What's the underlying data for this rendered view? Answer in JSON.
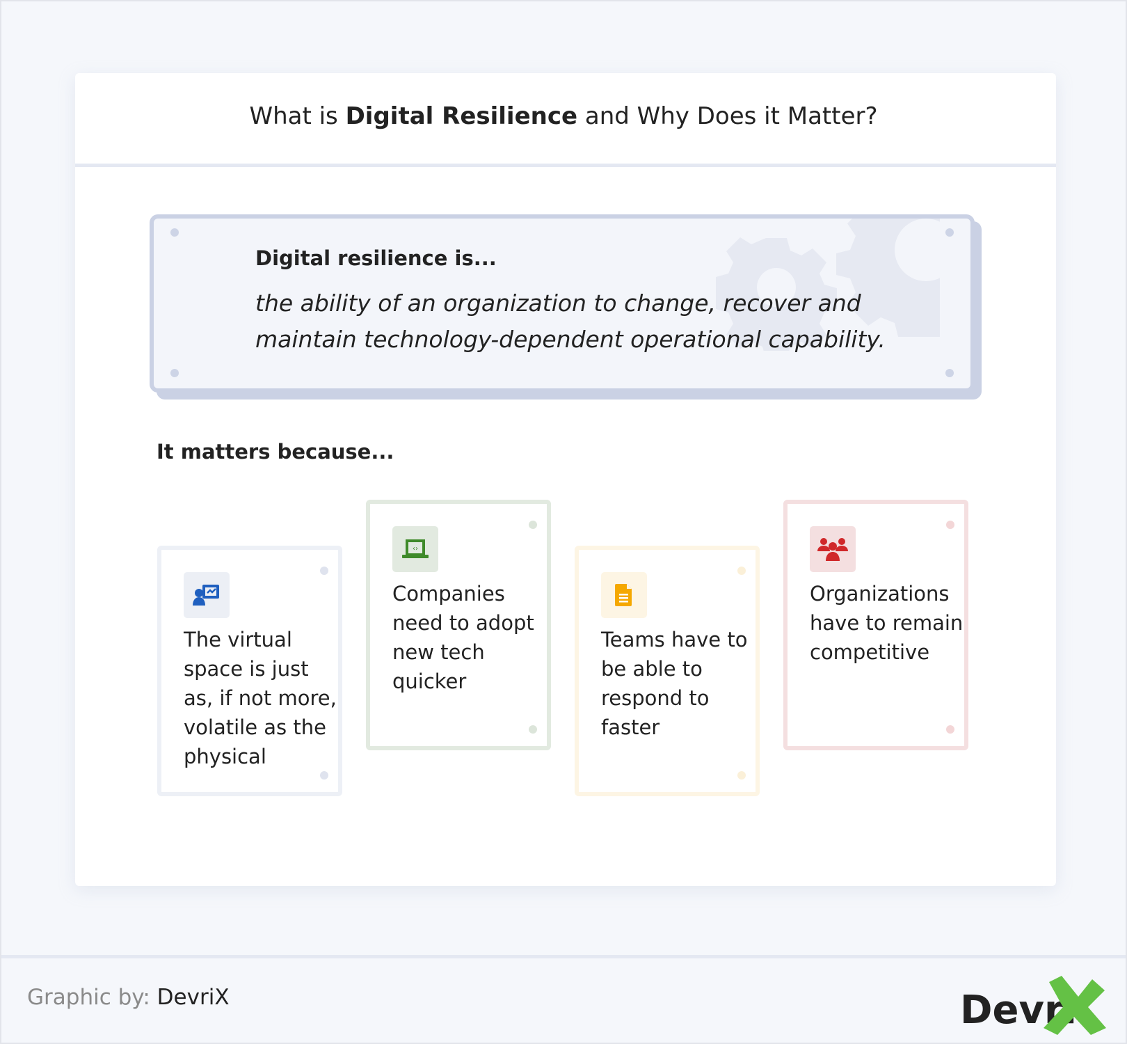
{
  "title": {
    "pre": "What is ",
    "bold": "Digital Resilience",
    "post": " and Why Does it Matter?"
  },
  "definition": {
    "heading": "Digital resilience is...",
    "text": "the ability of an organization to change, recover and maintain technology-dependent operational capability."
  },
  "matters_heading": "It matters because...",
  "reasons": [
    {
      "icon": "presentation-user-icon",
      "text": "The virtual space is just as, if not more, volatile as the physical",
      "color": "#1f5fbf"
    },
    {
      "icon": "laptop-code-icon",
      "text": "Companies need to adopt new tech quicker",
      "color": "#3f8a2a"
    },
    {
      "icon": "document-icon",
      "text": "Teams have to be able to respond to faster",
      "color": "#f5a800"
    },
    {
      "icon": "users-group-icon",
      "text": "Organizations have to remain competitive",
      "color": "#d0282a"
    }
  ],
  "footer": {
    "label": "Graphic by:",
    "value": "DevriX",
    "logo": "DevriX"
  }
}
